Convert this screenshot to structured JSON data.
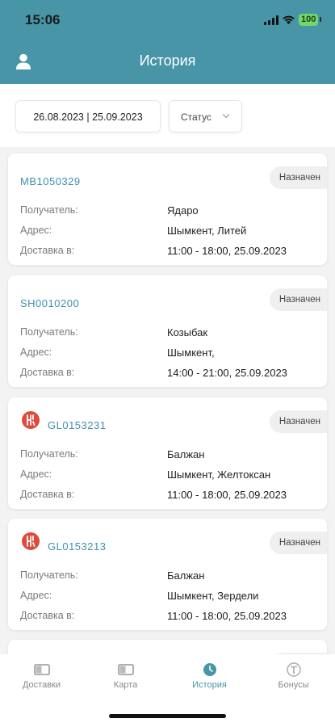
{
  "status_bar": {
    "time": "15:06",
    "battery": "100"
  },
  "header": {
    "title": "История",
    "user_icon": "user-icon"
  },
  "filters": {
    "date_range": "26.08.2023 | 25.09.2023",
    "status_label": "Статус"
  },
  "labels": {
    "recipient": "Получатель:",
    "address": "Адрес:",
    "delivery": "Доставка в:"
  },
  "orders": [
    {
      "id": "MB1050329",
      "status": "Назначен",
      "recipient": "Ядаро",
      "address": "Шымкент, Литей",
      "delivery": "11:00 - 18:00, 25.09.2023",
      "has_logo": false
    },
    {
      "id": "SH0010200",
      "status": "Назначен",
      "recipient": "Козыбак",
      "address": "Шымкент,",
      "delivery": "14:00 - 21:00, 25.09.2023",
      "has_logo": false
    },
    {
      "id": "GL0153231",
      "status": "Назначен",
      "recipient": "Балжан",
      "address": "Шымкент, Желтоксан",
      "delivery": "11:00 - 18:00, 25.09.2023",
      "has_logo": true
    },
    {
      "id": "GL0153213",
      "status": "Назначен",
      "recipient": "Балжан",
      "address": "Шымкент, Зердели",
      "delivery": "11:00 - 18:00, 25.09.2023",
      "has_logo": true
    }
  ],
  "tabs": [
    {
      "label": "Доставки",
      "icon": "deliveries-icon",
      "active": false
    },
    {
      "label": "Карта",
      "icon": "map-icon",
      "active": false
    },
    {
      "label": "История",
      "icon": "history-clock-icon",
      "active": true
    },
    {
      "label": "Бонусы",
      "icon": "bonus-coin-icon",
      "active": false
    }
  ],
  "colors": {
    "accent": "#4895a8",
    "link": "#3f8fb0",
    "brand_logo": "#de4a3b",
    "battery": "#6fd86a"
  }
}
